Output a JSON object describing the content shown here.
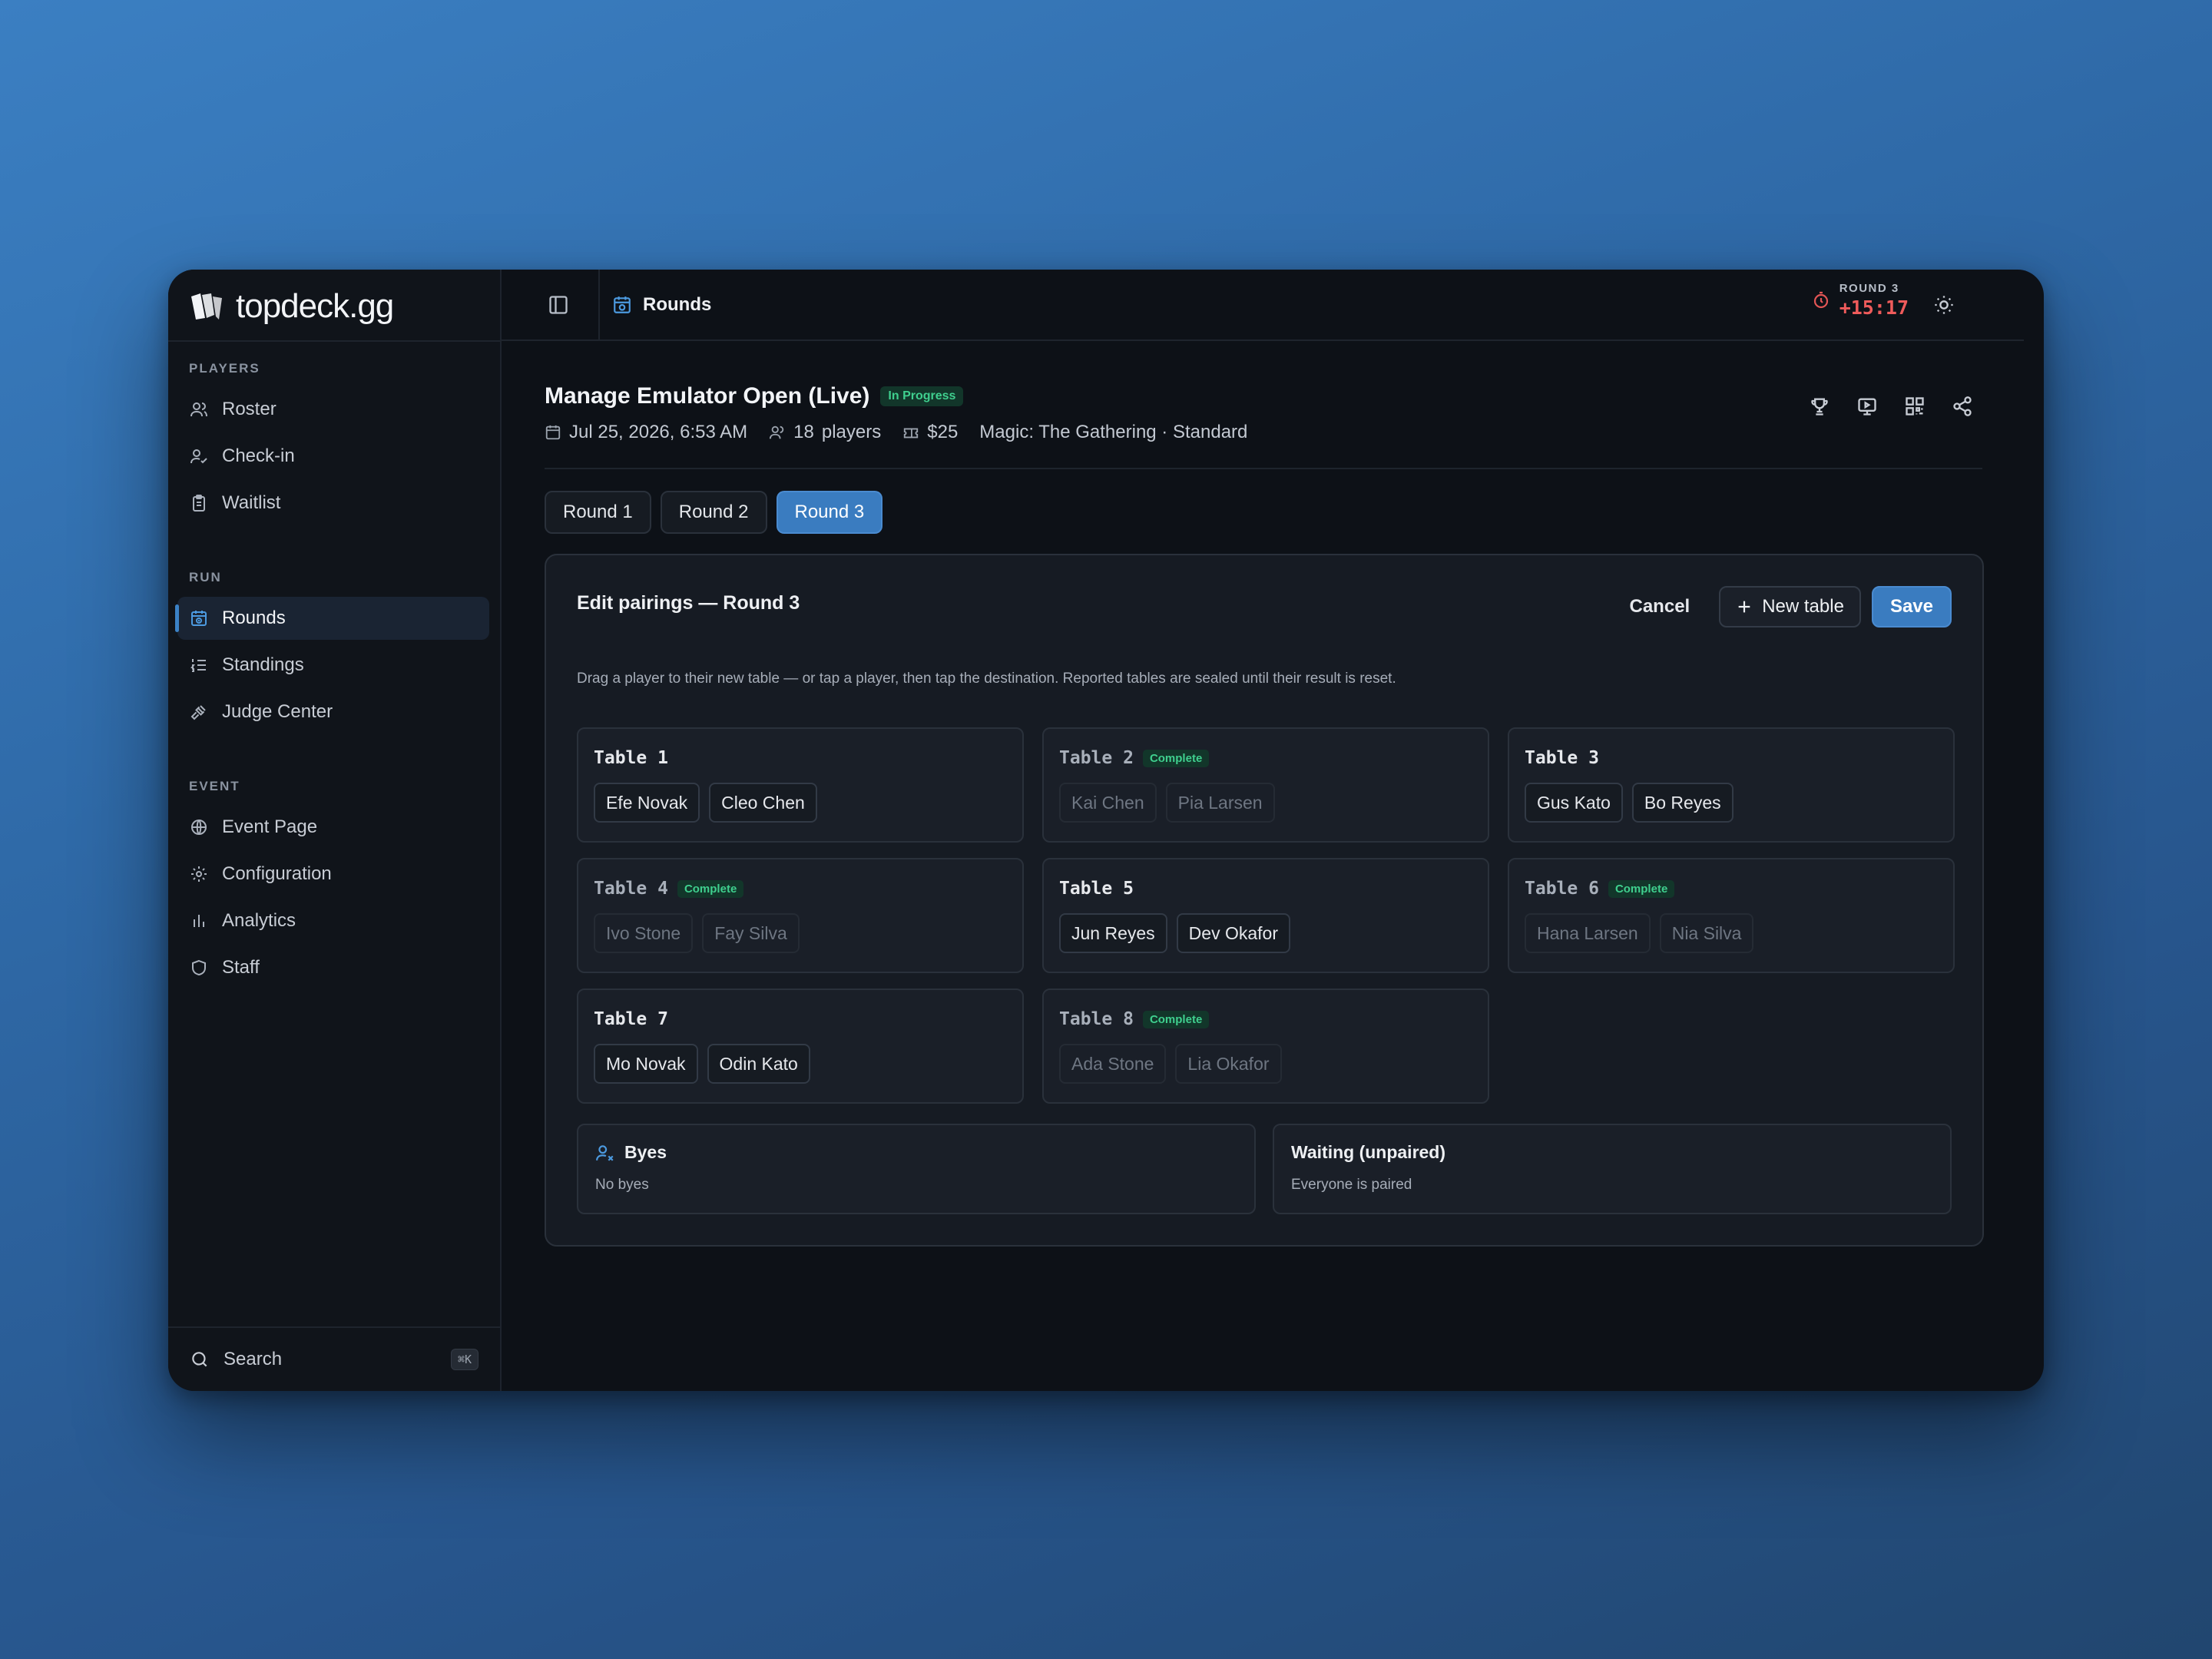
{
  "brand": {
    "name": "topdeck.gg"
  },
  "sidebar": {
    "sections": [
      {
        "heading": "PLAYERS",
        "items": [
          {
            "label": "Roster",
            "icon": "users-icon"
          },
          {
            "label": "Check-in",
            "icon": "user-check-icon"
          },
          {
            "label": "Waitlist",
            "icon": "clipboard-icon"
          }
        ]
      },
      {
        "heading": "RUN",
        "items": [
          {
            "label": "Rounds",
            "icon": "calendar-clock-icon",
            "active": true
          },
          {
            "label": "Standings",
            "icon": "list-ordered-icon"
          },
          {
            "label": "Judge Center",
            "icon": "gavel-icon"
          }
        ]
      },
      {
        "heading": "EVENT",
        "items": [
          {
            "label": "Event Page",
            "icon": "globe-icon"
          },
          {
            "label": "Configuration",
            "icon": "gear-icon"
          },
          {
            "label": "Analytics",
            "icon": "bar-chart-icon"
          },
          {
            "label": "Staff",
            "icon": "shield-icon"
          }
        ]
      }
    ],
    "search": {
      "label": "Search",
      "shortcut": "⌘K"
    }
  },
  "topbar": {
    "breadcrumb": "Rounds",
    "timer": {
      "label": "ROUND 3",
      "value": "+15:17",
      "color": "#ef5b5b"
    }
  },
  "event": {
    "title": "Manage Emulator Open (Live)",
    "status": "In Progress",
    "date": "Jul 25, 2026, 6:53 AM",
    "players": "18",
    "players_unit": "players",
    "fee": "$25",
    "format": "Magic: The Gathering · Standard"
  },
  "tabs": [
    {
      "label": "Round 1",
      "active": false
    },
    {
      "label": "Round 2",
      "active": false
    },
    {
      "label": "Round 3",
      "active": true
    }
  ],
  "editor": {
    "title": "Edit pairings — Round 3",
    "cancel_label": "Cancel",
    "new_table_label": "New table",
    "save_label": "Save",
    "help": "Drag a player to their new table — or tap a player, then tap the destination. Reported tables are sealed until their result is reset.",
    "complete_label": "Complete",
    "tables": [
      {
        "name": "Table 1",
        "complete": false,
        "players": [
          "Efe Novak",
          "Cleo Chen"
        ]
      },
      {
        "name": "Table 2",
        "complete": true,
        "players": [
          "Kai Chen",
          "Pia Larsen"
        ]
      },
      {
        "name": "Table 3",
        "complete": false,
        "players": [
          "Gus Kato",
          "Bo Reyes"
        ]
      },
      {
        "name": "Table 4",
        "complete": true,
        "players": [
          "Ivo Stone",
          "Fay Silva"
        ]
      },
      {
        "name": "Table 5",
        "complete": false,
        "players": [
          "Jun Reyes",
          "Dev Okafor"
        ]
      },
      {
        "name": "Table 6",
        "complete": true,
        "players": [
          "Hana Larsen",
          "Nia Silva"
        ]
      },
      {
        "name": "Table 7",
        "complete": false,
        "players": [
          "Mo Novak",
          "Odin Kato"
        ]
      },
      {
        "name": "Table 8",
        "complete": true,
        "players": [
          "Ada Stone",
          "Lia Okafor"
        ]
      }
    ],
    "byes": {
      "title": "Byes",
      "empty": "No byes"
    },
    "waiting": {
      "title": "Waiting (unpaired)",
      "empty": "Everyone is paired"
    }
  },
  "colors": {
    "accent": "#3a7cc0",
    "success": "#3fcf8e",
    "danger": "#ef5b5b"
  }
}
